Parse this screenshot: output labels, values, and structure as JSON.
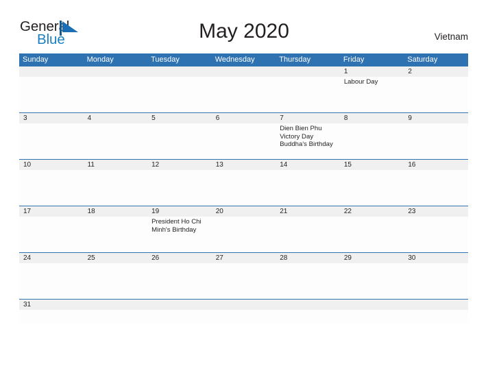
{
  "brand": {
    "name_part1": "General",
    "name_part2": "Blue",
    "mark": "triangle-flag-icon",
    "color_dark": "#231f20",
    "color_blue": "#1a7fc1"
  },
  "header": {
    "title": "May 2020",
    "country": "Vietnam"
  },
  "theme": {
    "header_bar": "#2e72b2",
    "date_band": "#f0f0f0",
    "cell_background": "#fdfdfd",
    "text": "#231f20",
    "header_text": "#ffffff"
  },
  "calendar": {
    "weekdays": [
      "Sunday",
      "Monday",
      "Tuesday",
      "Wednesday",
      "Thursday",
      "Friday",
      "Saturday"
    ],
    "weeks": [
      {
        "days": [
          {
            "date": "",
            "events": []
          },
          {
            "date": "",
            "events": []
          },
          {
            "date": "",
            "events": []
          },
          {
            "date": "",
            "events": []
          },
          {
            "date": "",
            "events": []
          },
          {
            "date": "1",
            "events": [
              "Labour Day"
            ]
          },
          {
            "date": "2",
            "events": []
          }
        ]
      },
      {
        "days": [
          {
            "date": "3",
            "events": []
          },
          {
            "date": "4",
            "events": []
          },
          {
            "date": "5",
            "events": []
          },
          {
            "date": "6",
            "events": []
          },
          {
            "date": "7",
            "events": [
              "Dien Bien Phu Victory Day",
              " Buddha's Birthday"
            ]
          },
          {
            "date": "8",
            "events": []
          },
          {
            "date": "9",
            "events": []
          }
        ]
      },
      {
        "days": [
          {
            "date": "10",
            "events": []
          },
          {
            "date": "11",
            "events": []
          },
          {
            "date": "12",
            "events": []
          },
          {
            "date": "13",
            "events": []
          },
          {
            "date": "14",
            "events": []
          },
          {
            "date": "15",
            "events": []
          },
          {
            "date": "16",
            "events": []
          }
        ]
      },
      {
        "days": [
          {
            "date": "17",
            "events": []
          },
          {
            "date": "18",
            "events": []
          },
          {
            "date": "19",
            "events": [
              "President Ho Chi Minh's Birthday"
            ]
          },
          {
            "date": "20",
            "events": []
          },
          {
            "date": "21",
            "events": []
          },
          {
            "date": "22",
            "events": []
          },
          {
            "date": "23",
            "events": []
          }
        ]
      },
      {
        "days": [
          {
            "date": "24",
            "events": []
          },
          {
            "date": "25",
            "events": []
          },
          {
            "date": "26",
            "events": []
          },
          {
            "date": "27",
            "events": []
          },
          {
            "date": "28",
            "events": []
          },
          {
            "date": "29",
            "events": []
          },
          {
            "date": "30",
            "events": []
          }
        ]
      },
      {
        "short": true,
        "days": [
          {
            "date": "31",
            "events": []
          },
          {
            "date": "",
            "events": []
          },
          {
            "date": "",
            "events": []
          },
          {
            "date": "",
            "events": []
          },
          {
            "date": "",
            "events": []
          },
          {
            "date": "",
            "events": []
          },
          {
            "date": "",
            "events": []
          }
        ]
      }
    ]
  }
}
